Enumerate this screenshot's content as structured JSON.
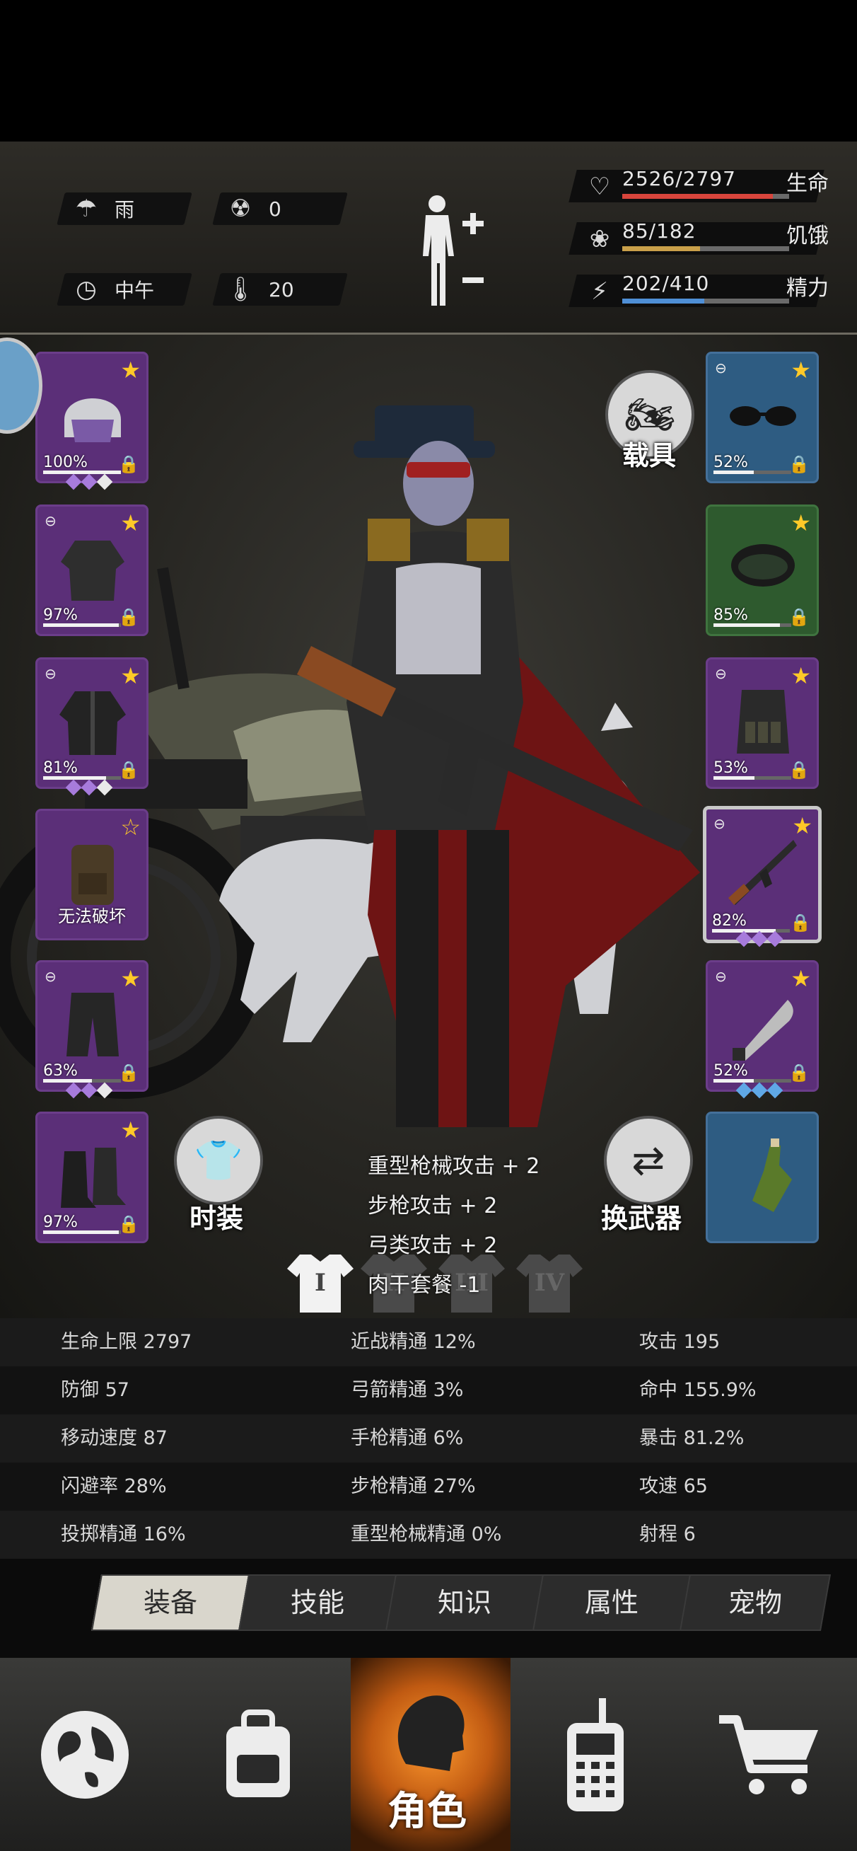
{
  "status": {
    "weather": {
      "icon": "rain-cloud-icon",
      "label": "雨"
    },
    "radiation": {
      "icon": "radiation-icon",
      "value": "0"
    },
    "time": {
      "icon": "clock-icon",
      "label": "中午"
    },
    "temperature": {
      "icon": "thermometer-icon",
      "value": "20"
    },
    "body_icon": "body-health-icon",
    "health": {
      "text": "2526/2797",
      "label": "生命",
      "fraction": 0.903,
      "color": "#d8453c"
    },
    "hunger": {
      "text": "85/182",
      "label": "饥饿",
      "fraction": 0.467,
      "color": "#c9a04a"
    },
    "energy": {
      "text": "202/410",
      "label": "精力",
      "fraction": 0.493,
      "color": "#4f8fd6"
    }
  },
  "equipment": {
    "left": [
      {
        "name": "police-helmet",
        "durability": "100%",
        "durability_fraction": 1.0,
        "star": "filled",
        "gems": [
          "#a77bdc",
          "#a77bdc",
          "#e9e9e9"
        ]
      },
      {
        "name": "jacket",
        "durability": "97%",
        "durability_fraction": 0.97,
        "star": "filled"
      },
      {
        "name": "coat",
        "durability": "81%",
        "durability_fraction": 0.81,
        "star": "filled",
        "gems": [
          "#a77bdc",
          "#a77bdc",
          "#e9e9e9"
        ]
      },
      {
        "name": "backpack",
        "durability_text": "无法破坏",
        "star": "hollow"
      },
      {
        "name": "pants",
        "durability": "63%",
        "durability_fraction": 0.63,
        "star": "filled",
        "gems": [
          "#a77bdc",
          "#a77bdc",
          "#e9e9e9"
        ]
      },
      {
        "name": "boots",
        "durability": "97%",
        "durability_fraction": 0.97,
        "star": "filled"
      }
    ],
    "right": [
      {
        "name": "sunglasses",
        "durability": "52%",
        "durability_fraction": 0.52,
        "star": "filled"
      },
      {
        "name": "gas-mask",
        "durability": "85%",
        "durability_fraction": 0.85,
        "star": "filled"
      },
      {
        "name": "tactical-vest",
        "durability": "53%",
        "durability_fraction": 0.53,
        "star": "filled"
      },
      {
        "name": "assault-rifle",
        "durability": "82%",
        "durability_fraction": 0.82,
        "star": "filled",
        "gems": [
          "#a77bdc",
          "#a77bdc",
          "#a77bdc"
        ]
      },
      {
        "name": "machete",
        "durability": "52%",
        "durability_fraction": 0.52,
        "star": "filled",
        "gems": [
          "#5fa8e6",
          "#5fa8e6",
          "#5fa8e6"
        ]
      },
      {
        "name": "molotov"
      }
    ]
  },
  "buttons": {
    "vehicle": {
      "label": "载具",
      "icon": "motorcycle-icon"
    },
    "fashion": {
      "label": "时装",
      "icon": "tshirt-icon"
    },
    "switch_weapon": {
      "label": "换武器",
      "icon": "swap-arrows-icon"
    }
  },
  "bonuses": [
    "重型枪械攻击 + 2",
    "步枪攻击 + 2",
    "弓类攻击 + 2",
    "肉干套餐 -1"
  ],
  "outfits": [
    "I",
    "II",
    "III",
    "IV"
  ],
  "stats": [
    [
      "生命上限 2797",
      "近战精通 12%",
      "攻击 195"
    ],
    [
      "防御 57",
      "弓箭精通 3%",
      "命中 155.9%"
    ],
    [
      "移动速度 87",
      "手枪精通 6%",
      "暴击 81.2%"
    ],
    [
      "闪避率 28%",
      "步枪精通 27%",
      "攻速 65"
    ],
    [
      "投掷精通 16%",
      "重型枪械精通 0%",
      "射程 6"
    ]
  ],
  "tabs": [
    {
      "label": "装备",
      "active": true
    },
    {
      "label": "技能",
      "active": false
    },
    {
      "label": "知识",
      "active": false
    },
    {
      "label": "属性",
      "active": false
    },
    {
      "label": "宠物",
      "active": false
    }
  ],
  "nav": [
    {
      "icon": "globe-icon",
      "label": ""
    },
    {
      "icon": "backpack-icon",
      "label": ""
    },
    {
      "icon": "character-head-icon",
      "label": "角色",
      "active": true
    },
    {
      "icon": "walkie-talkie-icon",
      "label": ""
    },
    {
      "icon": "shopping-cart-icon",
      "label": ""
    }
  ]
}
